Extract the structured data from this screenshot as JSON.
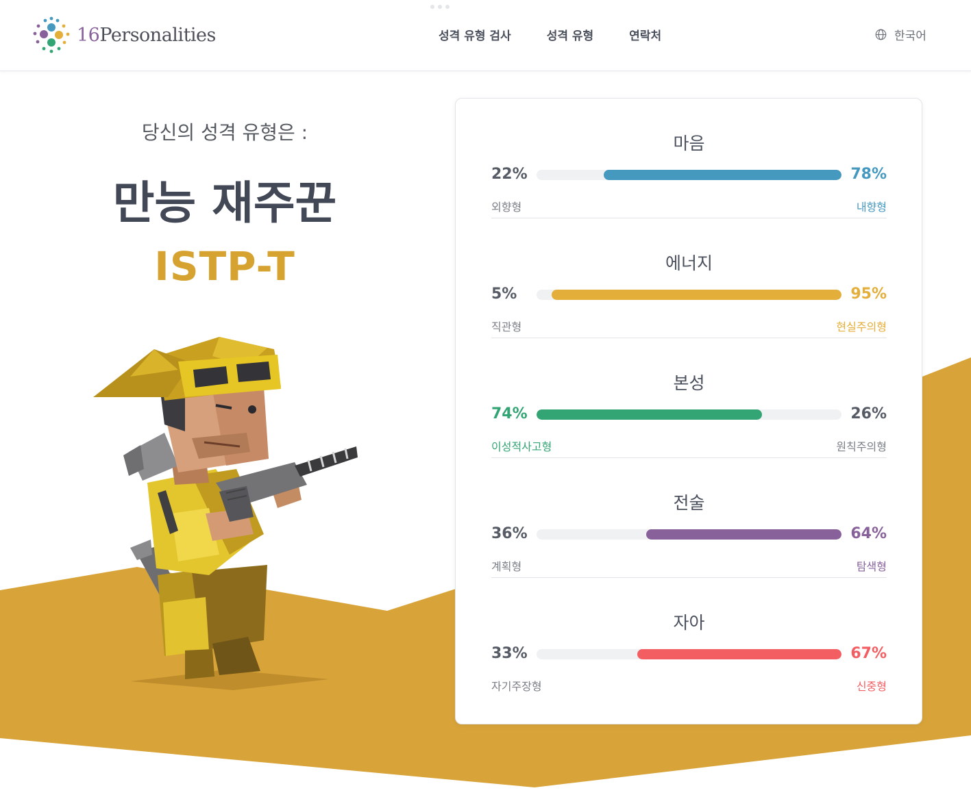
{
  "header": {
    "logo": {
      "number": "16",
      "text": "Personalities"
    },
    "nav": [
      {
        "label": "성격 유형 검사"
      },
      {
        "label": "성격 유형"
      },
      {
        "label": "연락처"
      }
    ],
    "language": "한국어"
  },
  "result": {
    "subtitle": "당신의 성격 유형은 :",
    "type_name": "만능 재주꾼",
    "type_code": "ISTP-T"
  },
  "colors": {
    "accent_gold": "#d6a331",
    "band": "#d8a43a",
    "mind": "#4599bf",
    "energy": "#e4ae3a",
    "nature": "#33a474",
    "tactics": "#88619a",
    "identity": "#f25e62"
  },
  "traits": [
    {
      "title": "마음",
      "left_pct": "22%",
      "right_pct": "78%",
      "left_label": "외향형",
      "right_label": "내향형",
      "dominant": "right",
      "value": 78,
      "color": "#4599bf"
    },
    {
      "title": "에너지",
      "left_pct": "5%",
      "right_pct": "95%",
      "left_label": "직관형",
      "right_label": "현실주의형",
      "dominant": "right",
      "value": 95,
      "color": "#e4ae3a"
    },
    {
      "title": "본성",
      "left_pct": "74%",
      "right_pct": "26%",
      "left_label": "이성적사고형",
      "right_label": "원칙주의형",
      "dominant": "left",
      "value": 74,
      "color": "#33a474"
    },
    {
      "title": "전술",
      "left_pct": "36%",
      "right_pct": "64%",
      "left_label": "계획형",
      "right_label": "탐색형",
      "dominant": "right",
      "value": 64,
      "color": "#88619a"
    },
    {
      "title": "자아",
      "left_pct": "33%",
      "right_pct": "67%",
      "left_label": "자기주장형",
      "right_label": "신중형",
      "dominant": "right",
      "value": 67,
      "color": "#f25e62"
    }
  ]
}
